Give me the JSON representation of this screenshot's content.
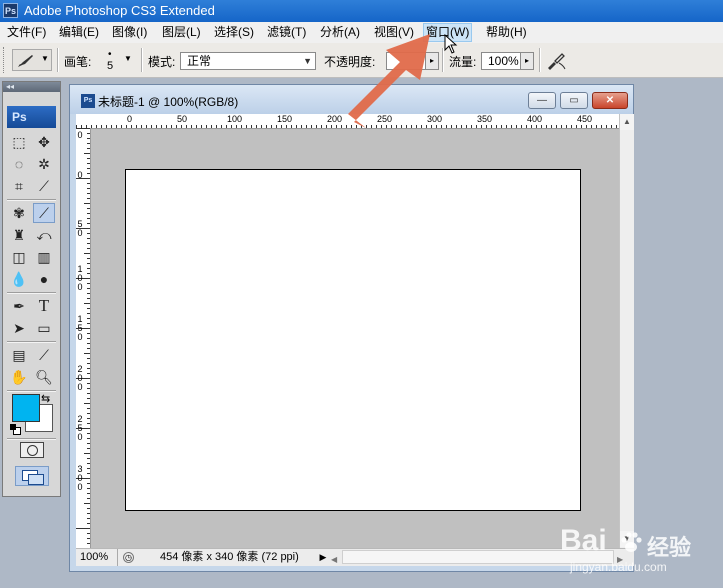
{
  "app": {
    "logo": "Ps",
    "title": "Adobe Photoshop CS3 Extended"
  },
  "menu": [
    "文件(F)",
    "编辑(E)",
    "图像(I)",
    "图层(L)",
    "选择(S)",
    "滤镜(T)",
    "分析(A)",
    "视图(V)",
    "窗口(W)",
    "帮助(H)"
  ],
  "hovered_menu": "窗口(W)",
  "options": {
    "brush_label": "画笔:",
    "brush_size": "5",
    "mode_label": "模式:",
    "mode_value": "正常",
    "opacity_label": "不透明度:",
    "flow_label": "流量:",
    "flow_value": "100%"
  },
  "tools": {
    "grip": "◂◂",
    "badge": "Ps"
  },
  "document": {
    "icon": "Ps",
    "title": "未标题-1 @ 100%(RGB/8)",
    "ruler_top_labels": [
      "0",
      "50",
      "100",
      "150",
      "200",
      "250",
      "300",
      "350",
      "400",
      "450"
    ],
    "ruler_left_labels": [
      "0",
      "0",
      "5",
      "0",
      "1",
      "0",
      "0",
      "1",
      "5",
      "0",
      "2",
      "0",
      "0",
      "2",
      "5",
      "0",
      "3",
      "0",
      "0"
    ],
    "zoom": "100%",
    "size_info": "454 像素 x 340 像素 (72 ppi)"
  },
  "annotation": {
    "color": "#e06a4a",
    "points_to": "窗口(W)"
  },
  "watermark": {
    "text1": "Bai",
    "text2": "经验",
    "url": "jingyan.baidu.com"
  },
  "colors": {
    "foreground": "#00b4f0",
    "background": "#ffffff"
  }
}
